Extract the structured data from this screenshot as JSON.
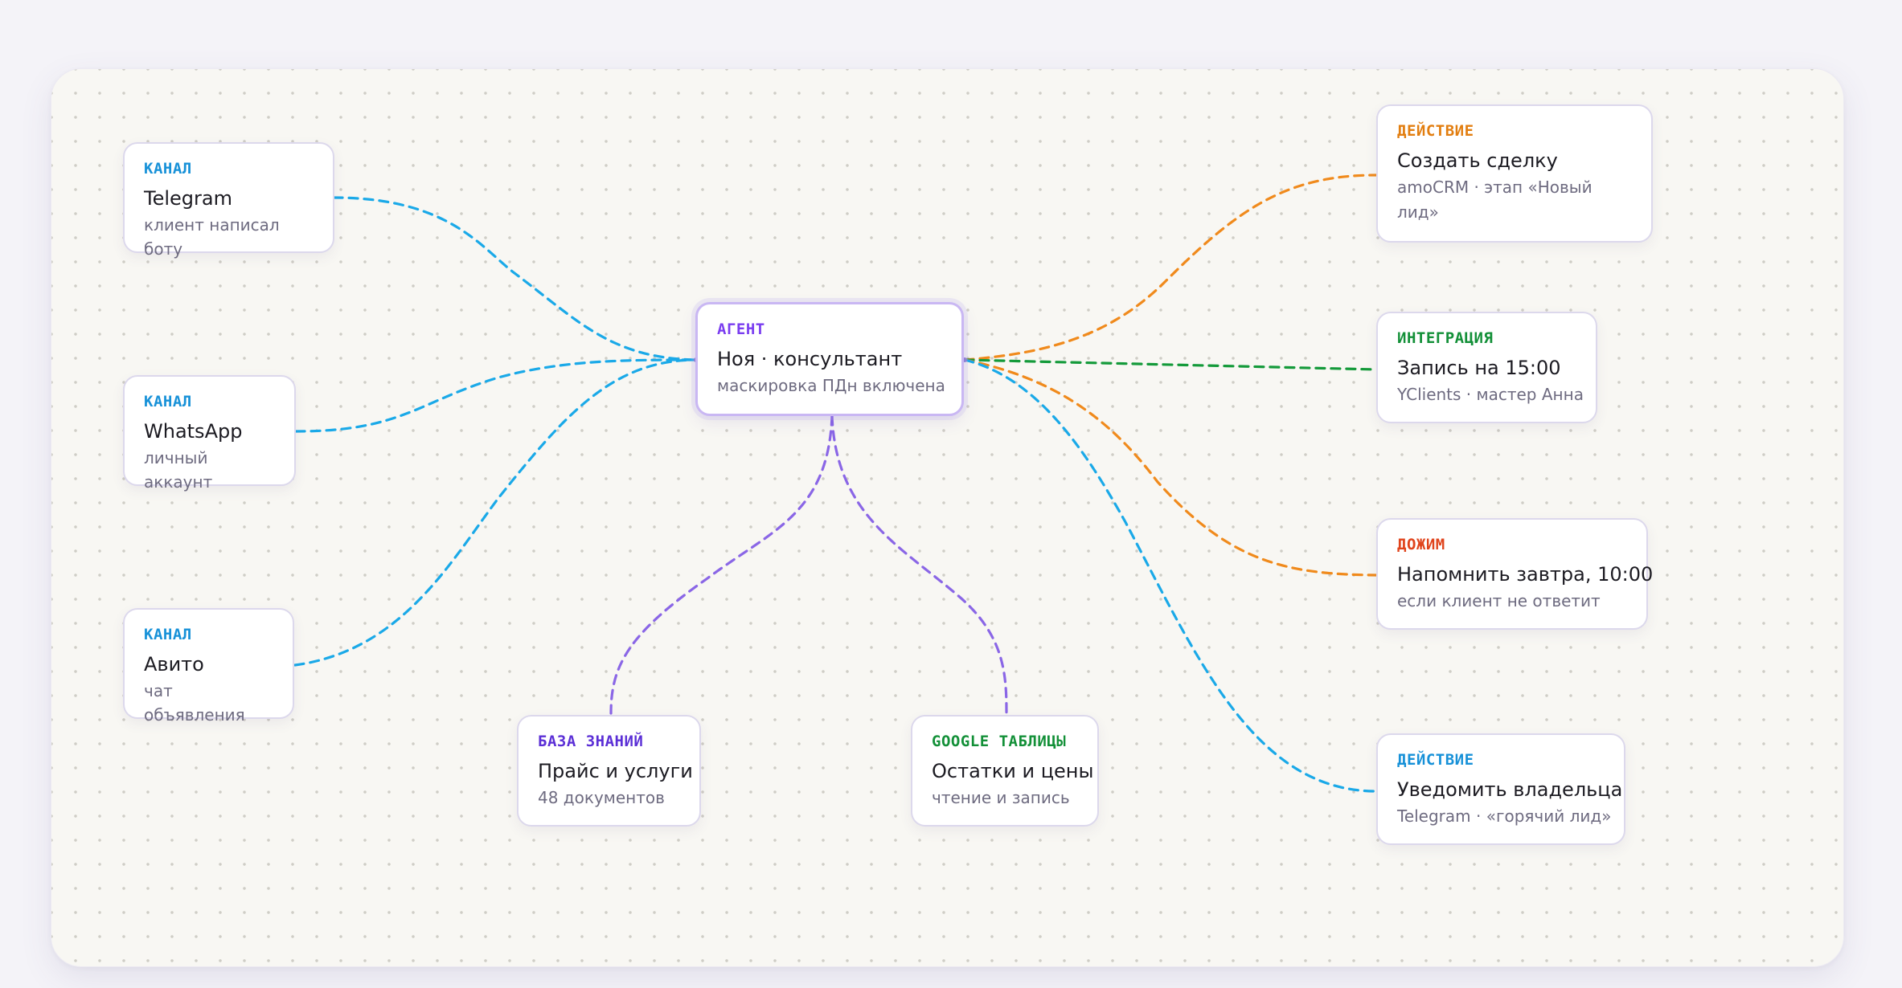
{
  "colors": {
    "blue": "#1aa9e8",
    "orange": "#f08a1c",
    "green": "#149a3a",
    "purple": "#8a66e6",
    "kind_blue": "#1791d8",
    "kind_orange": "#e27e10",
    "kind_green": "#139038",
    "kind_red": "#e0441c",
    "kind_purple": "#7a3df0",
    "kind_indigo": "#5b2fd6"
  },
  "nodes": {
    "telegram": {
      "kind": "КАНАЛ",
      "title": "Telegram",
      "sub": "клиент написал боту"
    },
    "whatsapp": {
      "kind": "КАНАЛ",
      "title": "WhatsApp",
      "sub": "личный аккаунт"
    },
    "avito": {
      "kind": "КАНАЛ",
      "title": "Авито",
      "sub": "чат объявления"
    },
    "agent": {
      "kind": "АГЕНТ",
      "title": "Ноя · консультант",
      "sub": "маскировка ПДн включена"
    },
    "knowledge": {
      "kind": "БАЗА ЗНАНИЙ",
      "title": "Прайс и услуги",
      "sub": "48 документов"
    },
    "sheets": {
      "kind": "GOOGLE ТАБЛИЦЫ",
      "title": "Остатки и цены",
      "sub": "чтение и запись"
    },
    "deal": {
      "kind": "ДЕЙСТВИЕ",
      "title": "Создать сделку",
      "sub": "amoCRM · этап «Новый лид»"
    },
    "booking": {
      "kind": "ИНТЕГРАЦИЯ",
      "title": "Запись на 15:00",
      "sub": "YClients · мастер Анна"
    },
    "followup": {
      "kind": "ДОЖИМ",
      "title": "Напомнить завтра, 10:00",
      "sub": "если клиент не ответит"
    },
    "notify": {
      "kind": "ДЕЙСТВИЕ",
      "title": "Уведомить владельца",
      "sub": "Telegram · «горячий лид»"
    }
  }
}
